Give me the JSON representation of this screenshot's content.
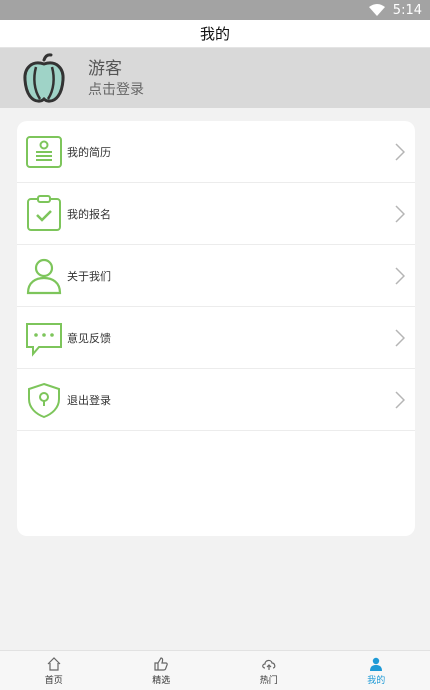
{
  "status_bar": {
    "time": "5:14"
  },
  "header": {
    "title": "我的"
  },
  "profile": {
    "name": "游客",
    "login_text": "点击登录"
  },
  "menu": [
    {
      "label": "我的简历",
      "icon": "resume-icon"
    },
    {
      "label": "我的报名",
      "icon": "clipboard-check-icon"
    },
    {
      "label": "关于我们",
      "icon": "user-icon"
    },
    {
      "label": "意见反馈",
      "icon": "chat-bubble-icon"
    },
    {
      "label": "退出登录",
      "icon": "shield-lock-icon"
    }
  ],
  "bottom_nav": [
    {
      "label": "首页",
      "icon": "home-icon",
      "active": false
    },
    {
      "label": "精选",
      "icon": "thumbs-up-icon",
      "active": false
    },
    {
      "label": "热门",
      "icon": "cloud-upload-icon",
      "active": false
    },
    {
      "label": "我的",
      "icon": "person-icon",
      "active": true
    }
  ],
  "colors": {
    "accent_green": "#7dc55b",
    "active_blue": "#1e9ad6"
  }
}
